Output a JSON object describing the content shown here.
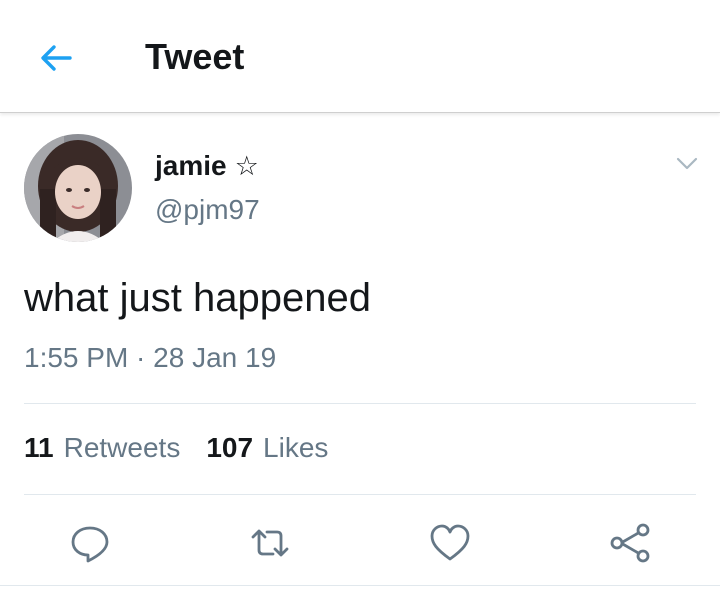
{
  "header": {
    "title": "Tweet",
    "back_icon": "back-arrow-icon",
    "accent_color": "#1da1f2"
  },
  "tweet": {
    "author_name": "jamie",
    "name_emoji": "☆",
    "handle": "@pjm97",
    "text": "what just happened",
    "time": "1:55 PM",
    "separator": " · ",
    "date": "28 Jan 19",
    "retweets_count": "11",
    "retweets_label": "Retweets",
    "likes_count": "107",
    "likes_label": "Likes"
  },
  "actions": [
    "reply-icon",
    "retweet-icon",
    "like-icon",
    "share-icon"
  ],
  "colors": {
    "text_primary": "#14171a",
    "text_secondary": "#657786",
    "divider": "#e1e8ed"
  }
}
